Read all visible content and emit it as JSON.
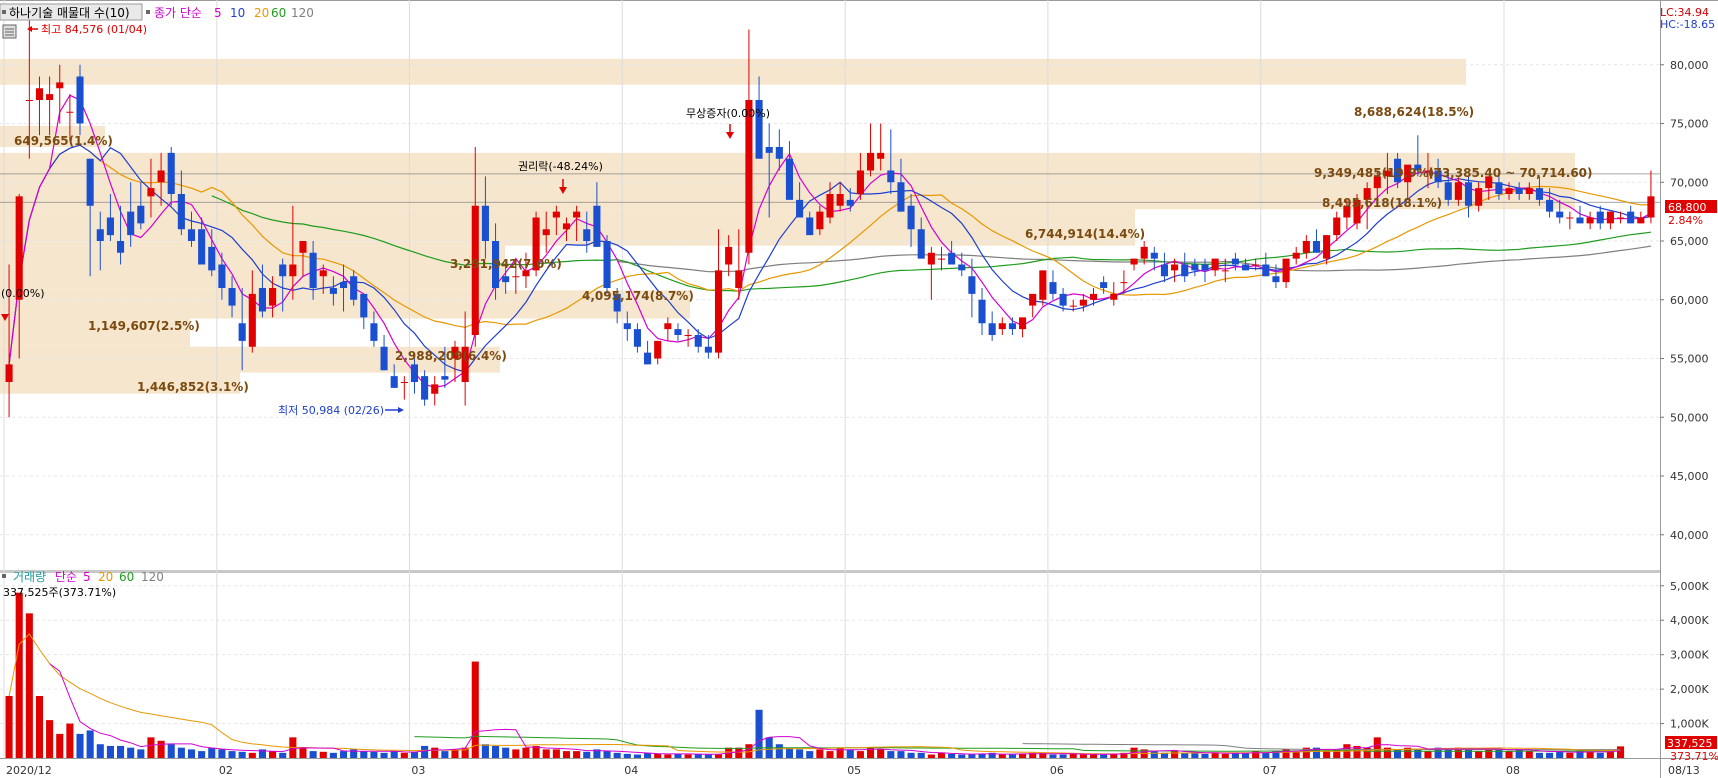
{
  "price_pane": {
    "legend": {
      "name": "하나기술 매물대 수(10)",
      "ma_label": "종가 단순",
      "periods": [
        "5",
        "10",
        "20",
        "60",
        "120"
      ]
    },
    "corner": {
      "lc": "LC:34.94",
      "hc": "HC:-18.65"
    },
    "y_ticks": [
      "80,000",
      "75,000",
      "70,000",
      "65,000",
      "60,000",
      "55,000",
      "50,000",
      "45,000",
      "40,000"
    ],
    "current_price": "68,800",
    "current_change": "2.84%",
    "annotations": {
      "high": "최고 84,576 (01/04)",
      "low": "최저 50,984 (02/26)",
      "rights": "권리락(-48.24%)",
      "bonus": "무상증자(0.00%)",
      "left_pct": "(0.00%)",
      "range": "(73,385.40 ~ 70,714.60)"
    },
    "volume_profile": [
      {
        "label": "8,688,624(18.5%)"
      },
      {
        "label": "9,349,485(19.9%)"
      },
      {
        "label": "8,495,618(18.1%)"
      },
      {
        "label": "6,744,914(14.4%)"
      },
      {
        "label": "649,565(1.4%)"
      },
      {
        "label": "3,291,942(7.0%)"
      },
      {
        "label": "4,095,174(8.7%)"
      },
      {
        "label": "1,149,607(2.5%)"
      },
      {
        "label": "2,988,209(6.4%)"
      },
      {
        "label": "1,446,852(3.1%)"
      }
    ]
  },
  "volume_pane": {
    "legend": {
      "name": "거래량",
      "ma_label": "단순",
      "periods": [
        "5",
        "20",
        "60",
        "120"
      ]
    },
    "last_value_label": "337,525주(373.71%)",
    "y_ticks": [
      "5,000K",
      "4,000K",
      "3,000K",
      "2,000K",
      "1,000K"
    ],
    "current_volume": "337,525",
    "current_ratio": "373.71%"
  },
  "x_axis": {
    "labels": [
      "2020/12",
      "02",
      "03",
      "04",
      "05",
      "06",
      "07",
      "08",
      "08/13"
    ]
  },
  "chart_data": {
    "type": "candlestick",
    "y_range": [
      37000,
      85000
    ],
    "volume_range": [
      0,
      5400000
    ],
    "ohlc": [
      [
        53000,
        63000,
        50000,
        54500
      ],
      [
        60000,
        69000,
        55000,
        68800
      ],
      [
        77000,
        84576,
        72000,
        77000
      ],
      [
        77000,
        79000,
        74000,
        78000
      ],
      [
        77000,
        79000,
        74000,
        77500
      ],
      [
        78000,
        80000,
        75000,
        78500
      ],
      [
        76000,
        77500,
        73500,
        76000
      ],
      [
        79000,
        80000,
        74000,
        75000
      ],
      [
        72000,
        72000,
        62000,
        68000
      ],
      [
        66000,
        67500,
        62500,
        65000
      ],
      [
        67000,
        69000,
        65000,
        65500
      ],
      [
        65000,
        68000,
        63000,
        64000
      ],
      [
        67500,
        70000,
        64500,
        65500
      ],
      [
        68000,
        70000,
        66000,
        66500
      ],
      [
        68800,
        72000,
        67000,
        69500
      ],
      [
        70000,
        72500,
        68000,
        71000
      ],
      [
        72500,
        73000,
        68000,
        69000
      ],
      [
        69000,
        71000,
        65500,
        66000
      ],
      [
        66000,
        67500,
        64500,
        65000
      ],
      [
        66000,
        67000,
        63000,
        63000
      ],
      [
        64500,
        66000,
        62000,
        62500
      ],
      [
        63000,
        64000,
        60000,
        61000
      ],
      [
        61000,
        62000,
        58500,
        59500
      ],
      [
        58000,
        61000,
        54000,
        56500
      ],
      [
        56000,
        62500,
        55500,
        60500
      ],
      [
        61000,
        63000,
        58500,
        59000
      ],
      [
        59500,
        62000,
        58500,
        61000
      ],
      [
        63000,
        63500,
        59000,
        62000
      ],
      [
        62000,
        68000,
        60000,
        63000
      ],
      [
        64000,
        65000,
        62000,
        65000
      ],
      [
        64000,
        65000,
        60000,
        61000
      ],
      [
        62000,
        63000,
        60500,
        62500
      ],
      [
        61000,
        62000,
        59500,
        60500
      ],
      [
        61500,
        63000,
        59000,
        61000
      ],
      [
        62000,
        62500,
        59500,
        60000
      ],
      [
        60500,
        60500,
        57500,
        58500
      ],
      [
        58000,
        59000,
        56000,
        56500
      ],
      [
        56000,
        57000,
        54000,
        54000
      ],
      [
        53500,
        54500,
        52500,
        52500
      ],
      [
        53000,
        53500,
        51500,
        53000
      ],
      [
        54500,
        55000,
        52000,
        53000
      ],
      [
        53500,
        54000,
        50984,
        51500
      ],
      [
        52000,
        53500,
        51000,
        52800
      ],
      [
        53500,
        56000,
        52500,
        53200
      ],
      [
        55000,
        56500,
        53000,
        56000
      ],
      [
        53000,
        59000,
        51000,
        56000
      ],
      [
        57000,
        73000,
        56000,
        68000
      ],
      [
        68000,
        70500,
        63500,
        65000
      ],
      [
        65000,
        66500,
        60000,
        61000
      ],
      [
        62000,
        63000,
        60500,
        61500
      ],
      [
        62000,
        63500,
        60500,
        62000
      ],
      [
        62000,
        64000,
        61000,
        62500
      ],
      [
        62500,
        67500,
        62000,
        67000
      ],
      [
        65500,
        67500,
        64000,
        66000
      ],
      [
        67000,
        68000,
        65500,
        67500
      ],
      [
        66000,
        67000,
        65000,
        66500
      ],
      [
        67000,
        68000,
        65000,
        67500
      ],
      [
        66000,
        67500,
        64000,
        65000
      ],
      [
        68000,
        70000,
        64500,
        64500
      ],
      [
        65000,
        65500,
        60500,
        61000
      ],
      [
        60500,
        61000,
        58000,
        59000
      ],
      [
        58000,
        59000,
        56500,
        57500
      ],
      [
        57500,
        58000,
        55500,
        56000
      ],
      [
        55500,
        56500,
        54500,
        54500
      ],
      [
        55000,
        56500,
        54500,
        56500
      ],
      [
        57500,
        58500,
        56500,
        58000
      ],
      [
        57500,
        58000,
        56500,
        57000
      ],
      [
        57000,
        57500,
        56000,
        57000
      ],
      [
        57000,
        57500,
        55500,
        56000
      ],
      [
        56000,
        57000,
        55000,
        55500
      ],
      [
        55500,
        66000,
        55000,
        62500
      ],
      [
        63000,
        65500,
        62000,
        64500
      ],
      [
        61000,
        66000,
        60000,
        62500
      ],
      [
        64000,
        83000,
        63000,
        77000
      ],
      [
        77000,
        79000,
        73500,
        72000
      ],
      [
        73000,
        75000,
        67000,
        72500
      ],
      [
        73000,
        74500,
        71000,
        72000
      ],
      [
        72000,
        73500,
        70000,
        68500
      ],
      [
        68500,
        70000,
        67500,
        67000
      ],
      [
        67000,
        67500,
        66000,
        65500
      ],
      [
        66000,
        68000,
        65500,
        67500
      ],
      [
        67000,
        70000,
        66500,
        69000
      ],
      [
        68000,
        70000,
        67500,
        69000
      ],
      [
        68500,
        69500,
        67500,
        68000
      ],
      [
        69000,
        72500,
        68500,
        71000
      ],
      [
        71000,
        75000,
        70500,
        72500
      ],
      [
        72000,
        75000,
        71000,
        72500
      ],
      [
        71000,
        74500,
        69000,
        70000
      ],
      [
        70000,
        72000,
        67500,
        67500
      ],
      [
        68000,
        69000,
        64500,
        66000
      ],
      [
        66000,
        67000,
        63500,
        63500
      ],
      [
        63000,
        64500,
        60000,
        64000
      ],
      [
        63500,
        64500,
        62500,
        63500
      ],
      [
        64000,
        65000,
        63000,
        63000
      ],
      [
        63000,
        64000,
        62000,
        62500
      ],
      [
        62000,
        63500,
        58500,
        60500
      ],
      [
        60000,
        61000,
        57000,
        58000
      ],
      [
        58000,
        59000,
        56500,
        57000
      ],
      [
        57500,
        58500,
        57000,
        58000
      ],
      [
        58000,
        58500,
        57000,
        57500
      ],
      [
        57500,
        58500,
        56800,
        58500
      ],
      [
        59500,
        60000,
        58500,
        60500
      ],
      [
        60000,
        62500,
        59500,
        62500
      ],
      [
        61500,
        62500,
        60000,
        60500
      ],
      [
        60500,
        61000,
        59000,
        59500
      ],
      [
        59500,
        60000,
        59000,
        59500
      ],
      [
        59500,
        60500,
        59000,
        60000
      ],
      [
        60000,
        61000,
        59500,
        60500
      ],
      [
        61500,
        62000,
        60500,
        61000
      ],
      [
        60000,
        61500,
        59500,
        60500
      ],
      [
        61500,
        62500,
        60500,
        61500
      ],
      [
        63000,
        63500,
        62500,
        63500
      ],
      [
        63500,
        65000,
        63000,
        64500
      ],
      [
        64000,
        64500,
        62500,
        63500
      ],
      [
        63000,
        64000,
        61500,
        62000
      ],
      [
        62500,
        63500,
        61500,
        63000
      ],
      [
        63000,
        64000,
        61500,
        62000
      ],
      [
        63000,
        63500,
        62000,
        62500
      ],
      [
        63000,
        63500,
        61500,
        62500
      ],
      [
        62500,
        63500,
        62000,
        63500
      ],
      [
        62500,
        63500,
        61500,
        62500
      ],
      [
        63500,
        64000,
        62500,
        63000
      ],
      [
        63000,
        63500,
        62500,
        62500
      ],
      [
        63000,
        63500,
        62500,
        63000
      ],
      [
        63000,
        64000,
        62000,
        62000
      ],
      [
        62000,
        63000,
        61000,
        61500
      ],
      [
        61500,
        63000,
        61000,
        63500
      ],
      [
        63500,
        64500,
        63000,
        64000
      ],
      [
        64000,
        65500,
        63500,
        65000
      ],
      [
        65000,
        66000,
        64000,
        64000
      ],
      [
        63500,
        65500,
        63000,
        65500
      ],
      [
        65500,
        67500,
        65000,
        67000
      ],
      [
        67000,
        68500,
        66000,
        68000
      ],
      [
        66500,
        69000,
        66000,
        68500
      ],
      [
        68500,
        70000,
        66000,
        69500
      ],
      [
        69500,
        71000,
        68500,
        70500
      ],
      [
        70500,
        72500,
        69000,
        71000
      ],
      [
        72000,
        72500,
        69500,
        70000
      ],
      [
        70000,
        71000,
        68500,
        71500
      ],
      [
        71500,
        74000,
        70500,
        71000
      ],
      [
        71000,
        72500,
        69500,
        71000
      ],
      [
        71000,
        72000,
        69500,
        70000
      ],
      [
        70000,
        71000,
        68000,
        68500
      ],
      [
        68500,
        70500,
        68000,
        70000
      ],
      [
        70000,
        70500,
        67000,
        68000
      ],
      [
        68000,
        70000,
        67500,
        69500
      ],
      [
        69500,
        70500,
        68500,
        70500
      ],
      [
        70000,
        71000,
        68500,
        69000
      ],
      [
        69000,
        70000,
        68500,
        69500
      ],
      [
        69500,
        70000,
        68500,
        69000
      ],
      [
        69000,
        70000,
        68500,
        69500
      ],
      [
        69500,
        70500,
        68000,
        68500
      ],
      [
        68500,
        69500,
        67000,
        67500
      ],
      [
        67500,
        68500,
        66500,
        67000
      ],
      [
        67000,
        67500,
        66000,
        67000
      ],
      [
        67000,
        68000,
        66500,
        66500
      ],
      [
        66500,
        67500,
        66000,
        67000
      ],
      [
        67500,
        68000,
        66000,
        66500
      ],
      [
        66500,
        67500,
        66000,
        67500
      ],
      [
        67000,
        67500,
        66500,
        67000
      ],
      [
        67500,
        68000,
        66500,
        66500
      ],
      [
        66500,
        67500,
        66500,
        67000
      ],
      [
        67000,
        71000,
        66500,
        68800
      ]
    ],
    "volume": [
      1800000,
      4800000,
      4200000,
      1800000,
      1100000,
      700000,
      1000000,
      700000,
      800000,
      400000,
      350000,
      350000,
      300000,
      250000,
      600000,
      500000,
      400000,
      300000,
      250000,
      200000,
      300000,
      250000,
      200000,
      180000,
      150000,
      250000,
      200000,
      150000,
      600000,
      300000,
      200000,
      180000,
      150000,
      200000,
      250000,
      200000,
      180000,
      150000,
      200000,
      150000,
      180000,
      350000,
      300000,
      200000,
      250000,
      300000,
      2800000,
      400000,
      350000,
      300000,
      250000,
      300000,
      350000,
      250000,
      250000,
      200000,
      200000,
      180000,
      250000,
      200000,
      150000,
      120000,
      100000,
      150000,
      120000,
      100000,
      120000,
      100000,
      120000,
      100000,
      100000,
      300000,
      300000,
      400000,
      1400000,
      600000,
      400000,
      300000,
      250000,
      200000,
      250000,
      200000,
      300000,
      250000,
      200000,
      300000,
      250000,
      200000,
      200000,
      150000,
      150000,
      100000,
      150000,
      120000,
      100000,
      100000,
      120000,
      150000,
      100000,
      100000,
      120000,
      150000,
      150000,
      100000,
      100000,
      120000,
      100000,
      120000,
      100000,
      120000,
      150000,
      300000,
      250000,
      200000,
      150000,
      200000,
      150000,
      150000,
      120000,
      150000,
      120000,
      150000,
      150000,
      200000,
      150000,
      200000,
      250000,
      200000,
      300000,
      300000,
      200000,
      250000,
      400000,
      350000,
      300000,
      600000,
      300000,
      250000,
      300000,
      250000,
      200000,
      300000,
      250000,
      300000,
      250000,
      200000,
      300000,
      250000,
      200000,
      250000,
      200000,
      150000,
      150000,
      200000,
      150000,
      200000,
      180000,
      150000,
      200000,
      337525
    ]
  }
}
